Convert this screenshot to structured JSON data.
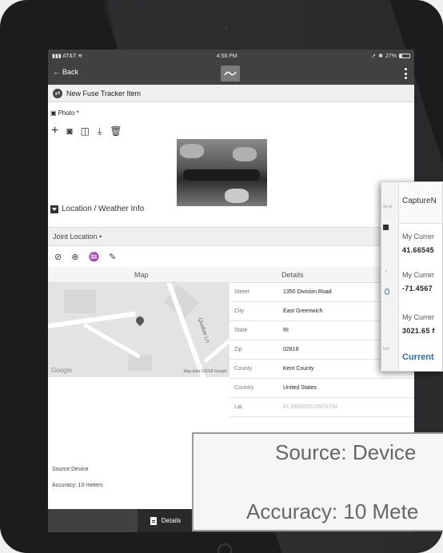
{
  "statusbar": {
    "carrier": "AT&T",
    "time": "4:58 PM",
    "battery": "27%",
    "battery_level": 0.27
  },
  "navbar": {
    "back_label": "Back",
    "menu_icon": "kebab-menu-icon"
  },
  "form": {
    "title": "New Fuse Tracker Item"
  },
  "photo": {
    "label": "Photo",
    "required_mark": "*"
  },
  "location_weather": {
    "label": "Location / Weather Info"
  },
  "joint_location": {
    "label": "Joint Location",
    "required_mark": "•"
  },
  "table": {
    "map_header": "Map",
    "details_header": "Details"
  },
  "map": {
    "google_label": "Google",
    "map_data": "Map data ©2018 Google",
    "street_label": "Quaker Ln"
  },
  "details": [
    {
      "label": "Street",
      "value": "1350 Division Road"
    },
    {
      "label": "City",
      "value": "East Greenwich"
    },
    {
      "label": "State",
      "value": "RI"
    },
    {
      "label": "Zip",
      "value": "02818"
    },
    {
      "label": "County",
      "value": "Kent County"
    },
    {
      "label": "Country",
      "value": "United States"
    },
    {
      "label": "Lat",
      "value": "41.665000570976794"
    }
  ],
  "source": {
    "text": "Source:Device"
  },
  "accuracy": {
    "text": "Accuracy: 10 meters"
  },
  "bottom_tab": {
    "label": "Details"
  },
  "popup": {
    "title": "CaptureN",
    "lat_label": "My Currer",
    "lat_value": "41.66545",
    "lon_label": "My Currer",
    "lon_value": "-71.4567",
    "alt_label": "My Currer",
    "alt_value": "3021.65 f",
    "current_label": "Current",
    "strip_text_1": "Se pi",
    "strip_text_2": "J",
    "strip_text_3": "Ind"
  },
  "zoom": {
    "source": "Source: Device",
    "accuracy": "Accuracy: 10 Mete"
  }
}
